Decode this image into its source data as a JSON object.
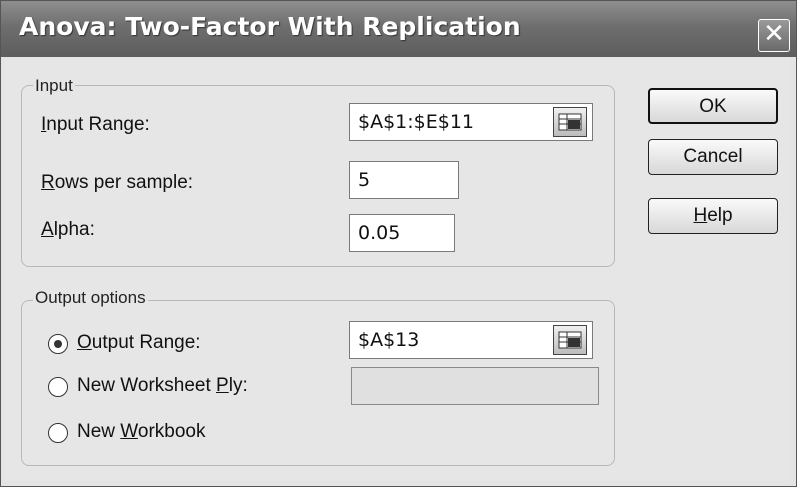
{
  "dialog": {
    "title": "Anova: Two-Factor With Replication",
    "close_label": "✕"
  },
  "input_group": {
    "legend": "Input",
    "input_range": {
      "label_pre": "",
      "label_u": "I",
      "label_post": "nput Range:",
      "value": "$A$1:$E$11"
    },
    "rows_per_sample": {
      "label_pre": "",
      "label_u": "R",
      "label_post": "ows per sample:",
      "value": "5"
    },
    "alpha": {
      "label_pre": "",
      "label_u": "A",
      "label_post": "lpha:",
      "value": "0.05"
    }
  },
  "output_group": {
    "legend": "Output options",
    "output_range": {
      "label_pre": "",
      "label_u": "O",
      "label_post": "utput Range:",
      "value": "$A$13",
      "selected": true
    },
    "new_worksheet": {
      "label_pre": "New Worksheet ",
      "label_u": "P",
      "label_post": "ly:",
      "value": "",
      "selected": false
    },
    "new_workbook": {
      "label_pre": "New ",
      "label_u": "W",
      "label_post": "orkbook",
      "selected": false
    }
  },
  "buttons": {
    "ok": "OK",
    "cancel": "Cancel",
    "help_u": "H",
    "help_post": "elp"
  }
}
